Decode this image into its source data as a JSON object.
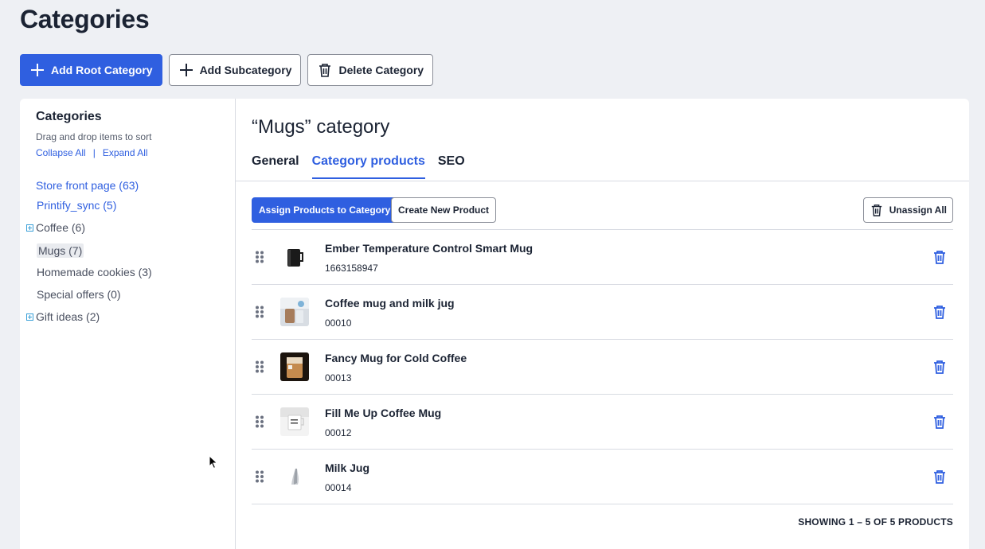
{
  "page": {
    "title": "Categories"
  },
  "toolbar": {
    "add_root": "Add Root Category",
    "add_sub": "Add Subcategory",
    "delete": "Delete Category"
  },
  "sidebar": {
    "title": "Categories",
    "hint": "Drag and drop items to sort",
    "collapse_all": "Collapse All",
    "separator": "|",
    "expand_all": "Expand All",
    "items": [
      {
        "label": "Store front page (63)"
      },
      {
        "label": "Printify_sync (5)"
      },
      {
        "label": "Coffee (6)"
      },
      {
        "label": "Mugs (7)"
      },
      {
        "label": "Homemade cookies (3)"
      },
      {
        "label": "Special offers (0)"
      },
      {
        "label": "Gift ideas (2)"
      }
    ]
  },
  "main": {
    "title": "“Mugs” category",
    "tabs": [
      {
        "label": "General"
      },
      {
        "label": "Category products"
      },
      {
        "label": "SEO"
      }
    ],
    "assign_btn": "Assign Products to Category",
    "create_btn": "Create New Product",
    "unassign_btn": "Unassign All",
    "products": [
      {
        "name": "Ember Temperature Control Smart Mug",
        "sku": "1663158947"
      },
      {
        "name": "Coffee mug and milk jug",
        "sku": "00010"
      },
      {
        "name": "Fancy Mug for Cold Coffee",
        "sku": "00013"
      },
      {
        "name": "Fill Me Up Coffee Mug",
        "sku": "00012"
      },
      {
        "name": "Milk Jug",
        "sku": "00014"
      }
    ],
    "showing": "SHOWING 1 – 5 OF 5 PRODUCTS"
  },
  "colors": {
    "accent": "#2f5fe0",
    "tree_expander": "#3aa0d8"
  }
}
